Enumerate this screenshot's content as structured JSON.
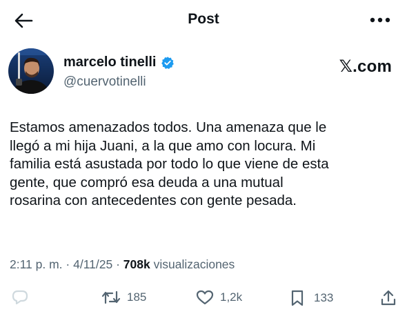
{
  "header": {
    "title": "Post",
    "back_icon": "arrow-left-icon",
    "more_icon": "more-horizontal-icon"
  },
  "author": {
    "display_name": "marcelo tinelli",
    "handle": "@cuervotinelli",
    "verified": true,
    "verified_color": "#1d9bf0"
  },
  "brand": {
    "label": "𝕏.com"
  },
  "post": {
    "text": "Estamos amenazados todos. Una amenaza que le\nllegó a mi hija Juani, a la que amo con locura. Mi\nfamilia está asustada por todo lo que viene de esta\ngente, que compró esa deuda a una mutual\nrosarina con antecedentes con gente pesada."
  },
  "meta": {
    "time": "2:11 p. m.",
    "separator": "·",
    "date": "4/11/25",
    "views": "708k",
    "views_label": "visualizaciones"
  },
  "actions": {
    "reply_icon": "reply-icon",
    "repost_icon": "repost-icon",
    "repost_count": "185",
    "like_icon": "heart-icon",
    "like_count": "1,2k",
    "bookmark_icon": "bookmark-icon",
    "bookmark_count": "133",
    "share_icon": "share-icon"
  },
  "colors": {
    "text": "#0f1419",
    "secondary": "#536471",
    "reply_icon": "#cfd9de"
  }
}
